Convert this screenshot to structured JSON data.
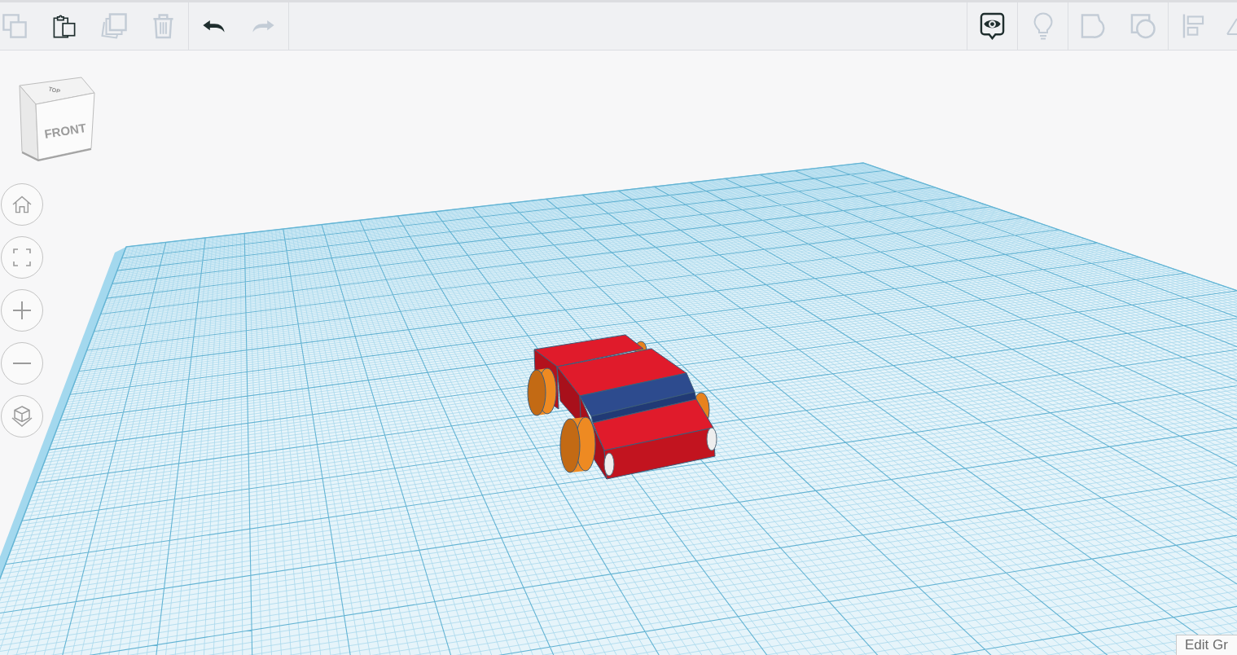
{
  "toolbar": {
    "left_groups": [
      {
        "buttons": [
          {
            "kind": "copy",
            "disabled": true
          },
          {
            "kind": "paste",
            "disabled": false
          },
          {
            "kind": "duplicate",
            "disabled": true
          },
          {
            "kind": "delete",
            "disabled": true
          }
        ]
      },
      {
        "buttons": [
          {
            "kind": "undo",
            "disabled": false
          },
          {
            "kind": "redo",
            "disabled": true
          }
        ]
      }
    ],
    "right_groups": [
      {
        "buttons": [
          {
            "kind": "notes",
            "disabled": false
          }
        ]
      },
      {
        "buttons": [
          {
            "kind": "hint",
            "disabled": true
          }
        ]
      },
      {
        "buttons": [
          {
            "kind": "group",
            "disabled": true
          },
          {
            "kind": "ungroup",
            "disabled": true
          }
        ]
      },
      {
        "buttons": [
          {
            "kind": "align",
            "disabled": true
          },
          {
            "kind": "mirror",
            "disabled": true
          }
        ]
      }
    ]
  },
  "view_cube": {
    "top_label": "TOP",
    "front_label": "FRONT"
  },
  "view_controls": [
    {
      "kind": "home"
    },
    {
      "kind": "fit"
    },
    {
      "kind": "zoom_in"
    },
    {
      "kind": "zoom_out"
    },
    {
      "kind": "projection"
    }
  ],
  "edit_grid_button": {
    "label": "Edit Gr"
  }
}
